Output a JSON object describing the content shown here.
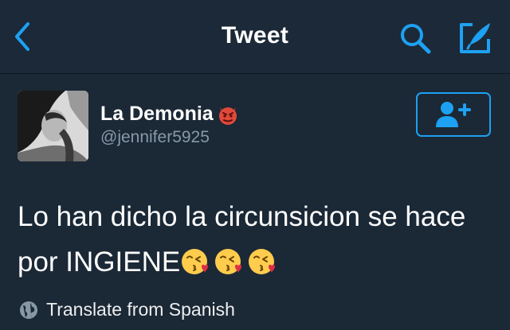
{
  "header": {
    "title": "Tweet"
  },
  "user": {
    "name": "La Demonia",
    "handle": "@jennifer5925"
  },
  "tweet": {
    "text": "Lo han dicho la circunsicion se hace por INGIENE",
    "emoji_count": 3
  },
  "footer": {
    "translate_label": "Translate from Spanish"
  },
  "colors": {
    "background": "#1b2836",
    "accent": "#1da1f2",
    "secondary_text": "#8899a6"
  },
  "icons": {
    "back": "chevron-left-icon",
    "search": "search-icon",
    "compose": "compose-icon",
    "follow": "add-user-icon",
    "name_emoji": "devil-emoji-icon",
    "tweet_emoji": "kissing-heart-emoji-icon",
    "translate": "globe-icon"
  }
}
